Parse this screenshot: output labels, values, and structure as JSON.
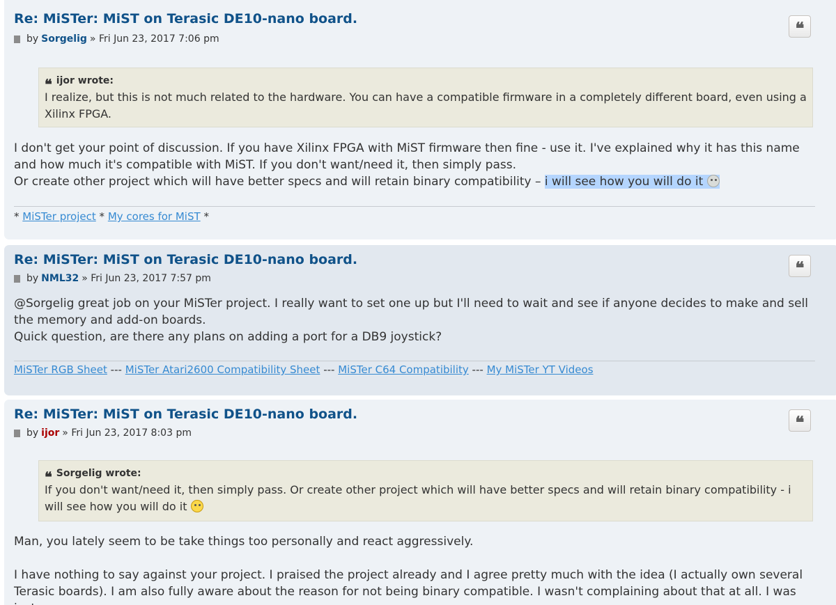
{
  "posts": [
    {
      "title": "Re: MiSTer: MiST on Terasic DE10-nano board.",
      "by": "by",
      "author": "Sorgelig",
      "date": "» Fri Jun 23, 2017 7:06 pm",
      "quote_author": "ijor wrote:",
      "quote_text": "I realize, but this is not much related to the hardware. You can have a compatible firmware in a completely different board, even using a Xilinx FPGA.",
      "body_line1": "I don't get your point of discussion. If you have Xilinx FPGA with MiST firmware then fine - use it. I've explained why it has this name and how much it's compatible with MiST. If you don't want/need it, then simply pass.",
      "body_line2_start": "Or create other project which will have better specs and will retain binary compatibility – ",
      "body_line2_highlight": "i will see how you will do it",
      "signature": {
        "prefix": "*",
        "link1": "MiSTer project",
        "mid": "*",
        "link2": "My cores for MiST",
        "suffix": "*"
      }
    },
    {
      "title": "Re: MiSTer: MiST on Terasic DE10-nano board.",
      "by": "by",
      "author": "NML32",
      "date": "» Fri Jun 23, 2017 7:57 pm",
      "body_line1": "@Sorgelig great job on your MiSTer project. I really want to set one up but I'll need to wait and see if anyone decides to make and sell the memory and add-on boards.",
      "body_line2": "Quick question, are there any plans on adding a port for a DB9 joystick?",
      "signature": {
        "link1": "MiSTer RGB Sheet",
        "sep": "---",
        "link2": "MiSTer Atari2600 Compatibility Sheet",
        "link3": "MiSTer C64 Compatibility",
        "link4": "My MiSTer YT Videos"
      }
    },
    {
      "title": "Re: MiSTer: MiST on Terasic DE10-nano board.",
      "by": "by",
      "author": "ijor",
      "date": "» Fri Jun 23, 2017 8:03 pm",
      "quote_author": "Sorgelig wrote:",
      "quote_text": "If you don't want/need it, then simply pass. Or create other project which will have better specs and will retain binary compatibility - i will see how you will do it",
      "body_line1": "Man, you lately seem to be take things too personally and react aggressively.",
      "body_line2": "I have nothing to say against your project. I praised the project already and I agree pretty much with the idea (I actually own several Terasic boards). I am also fully aware about the reason for not being binary compatible. I wasn't complaining about that at all. I was just"
    }
  ],
  "quote_glyph": "❝",
  "colors": {
    "title": "#105289",
    "link": "#368ad2",
    "post_bg_1": "#eef2f6",
    "post_bg_2": "#e2e8ef",
    "quote_bg": "#ebeadd",
    "highlight": "#b4d5fe",
    "author_red": "#aa0000"
  },
  "icons": {
    "quote_button": "quote-icon",
    "post_marker": "document-icon",
    "smiley_grey": "wink-smiley-icon",
    "smiley_yellow": "wink-smiley-icon"
  }
}
